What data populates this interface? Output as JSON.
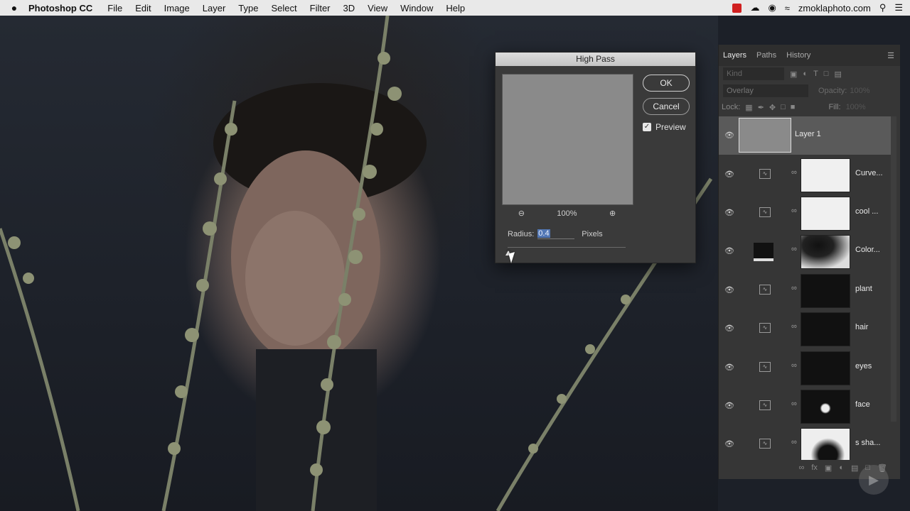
{
  "menubar": {
    "apple": "",
    "app_name": "Photoshop CC",
    "items": [
      "File",
      "Edit",
      "Image",
      "Layer",
      "Type",
      "Select",
      "Filter",
      "3D",
      "View",
      "Window",
      "Help"
    ],
    "account": "zmoklaphoto.com",
    "icons": [
      "app-badge-icon",
      "cloud-icon",
      "creative-cloud-icon",
      "wifi-icon",
      "search-icon",
      "list-icon"
    ]
  },
  "dialog": {
    "title": "High Pass",
    "ok_label": "OK",
    "cancel_label": "Cancel",
    "preview_label": "Preview",
    "preview_checked": true,
    "zoom": "100%",
    "radius_label": "Radius:",
    "radius_value": "0.4",
    "radius_unit": "Pixels",
    "slider_level": 0.0
  },
  "panel": {
    "tabs": [
      "Layers",
      "Paths",
      "History"
    ],
    "filter_kind": "Kind",
    "blend_mode": "Overlay",
    "opacity_label": "Opacity:",
    "opacity_value": "100%",
    "lock_label": "Lock:",
    "fill_label": "Fill:",
    "fill_value": "100%",
    "layers": [
      {
        "name": "Layer 1",
        "selected": true,
        "thumb": "#8a8a8a"
      },
      {
        "name": "Curve...",
        "thumb": "#f0f0f0"
      },
      {
        "name": "cool ...",
        "thumb": "#f0f0f0"
      },
      {
        "name": "Color...",
        "thumb": "mask-dark"
      },
      {
        "name": "plant",
        "thumb": "#111111"
      },
      {
        "name": "hair",
        "thumb": "#111111"
      },
      {
        "name": "eyes",
        "thumb": "#111111"
      },
      {
        "name": "face",
        "thumb": "#111111"
      },
      {
        "name": "s sha...",
        "thumb": "#eeeeee"
      }
    ]
  }
}
